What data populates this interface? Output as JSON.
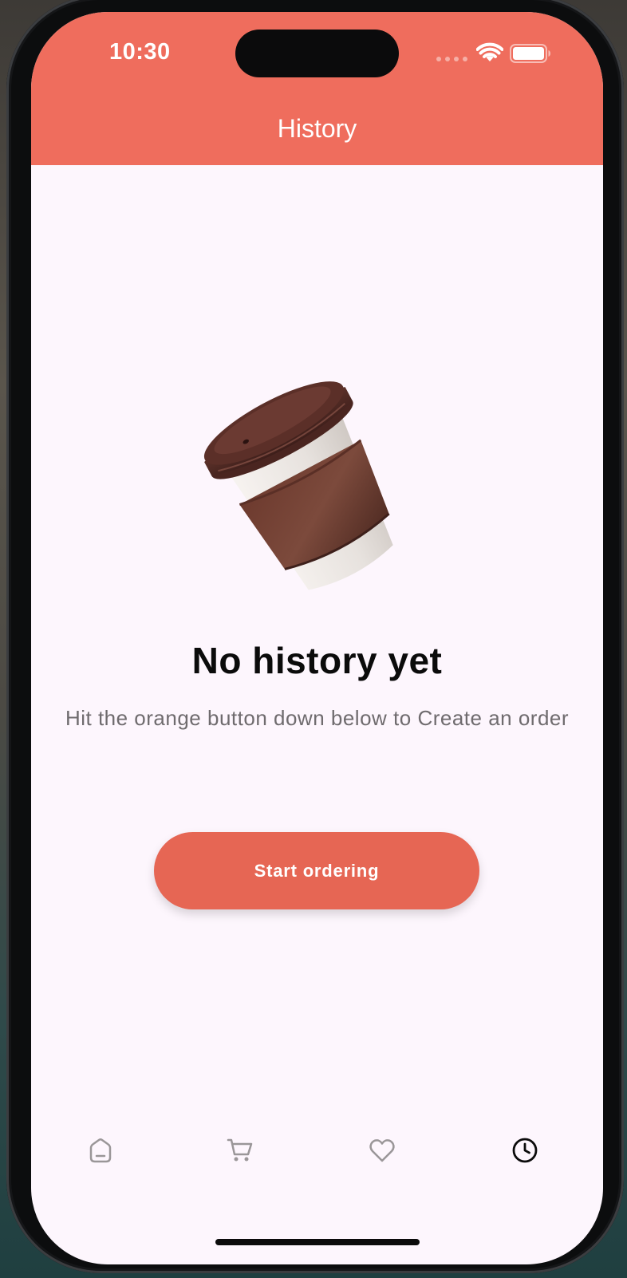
{
  "status_bar": {
    "time": "10:30",
    "signal_icon": "signal-dots-icon",
    "wifi_icon": "wifi-icon",
    "battery_icon": "battery-icon"
  },
  "header": {
    "title": "History",
    "background_color": "#ef6d5d"
  },
  "empty_state": {
    "illustration": "coffee-cup-illustration",
    "title": "No history yet",
    "description": "Hit the orange button down below to Create an order",
    "button_label": "Start ordering",
    "button_color": "#e66654"
  },
  "bottom_nav": {
    "items": [
      {
        "icon": "home-icon",
        "active": false
      },
      {
        "icon": "cart-icon",
        "active": false
      },
      {
        "icon": "heart-icon",
        "active": false
      },
      {
        "icon": "clock-icon",
        "active": true
      }
    ],
    "active_color": "#0b0b0b",
    "inactive_color": "#9a9698"
  },
  "colors": {
    "screen_background": "#fdf6fd",
    "title_text": "#0b0b0b",
    "description_text": "#6f6b6e"
  }
}
